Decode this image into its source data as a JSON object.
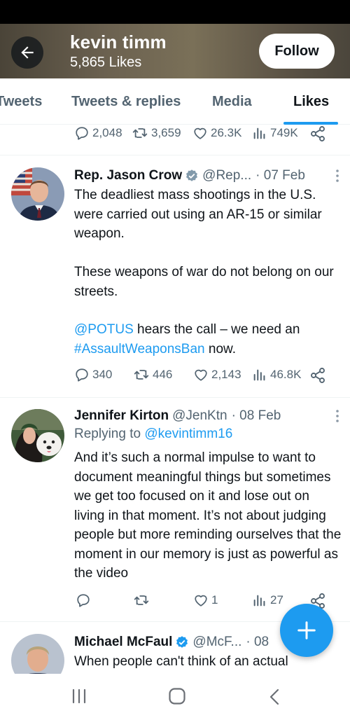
{
  "header": {
    "profile_name": "kevin timm",
    "likes_count": "5,865 Likes",
    "follow_label": "Follow"
  },
  "tabs": [
    {
      "label": "Tweets",
      "active": false
    },
    {
      "label": "Tweets & replies",
      "active": false
    },
    {
      "label": "Media",
      "active": false
    },
    {
      "label": "Likes",
      "active": true
    }
  ],
  "top_partial_tweet": {
    "replies": "2,048",
    "retweets": "3,659",
    "likes": "26.3K",
    "views": "749K"
  },
  "tweets": [
    {
      "name": "Rep. Jason Crow",
      "verified": true,
      "handle": "@Rep...",
      "date": "· 07 Feb",
      "body_p1": "The deadliest mass shootings in the U.S. were carried out using an AR-15 or similar weapon.",
      "body_p2": "These weapons of war do not belong on our streets.",
      "mention": "@POTUS",
      "body_p3_mid": " hears the call – we need an ",
      "hashtag": "#AssaultWeaponsBan",
      "body_p3_end": " now.",
      "replies": "340",
      "retweets": "446",
      "likes": "2,143",
      "views": "46.8K"
    },
    {
      "name": "Jennifer Kirton",
      "verified": false,
      "handle": "@JenKtn",
      "date": "· 08 Feb",
      "replying_prefix": "Replying to ",
      "replying_to": "@kevintimm16",
      "body": "And it’s such a normal impulse to want to document meaningful things but sometimes we get too focused on it and lose out on living in that moment. It’s not about judging people but more reminding ourselves that the moment in our memory is just as powerful as the video",
      "replies": "",
      "retweets": "",
      "likes": "1",
      "views": "27"
    },
    {
      "name": "Michael McFaul",
      "verified": true,
      "handle": "@McF...",
      "date": "· 08",
      "body": "When people can't think of an actual"
    }
  ],
  "colors": {
    "accent": "#1d9bf0",
    "text": "#0f1419",
    "secondary": "#536471"
  },
  "icons": [
    "back-arrow-icon",
    "reply-icon",
    "retweet-icon",
    "like-icon",
    "views-icon",
    "share-icon",
    "more-icon",
    "verified-badge-icon",
    "compose-plus-icon",
    "recents-icon",
    "home-icon",
    "back-nav-icon"
  ]
}
